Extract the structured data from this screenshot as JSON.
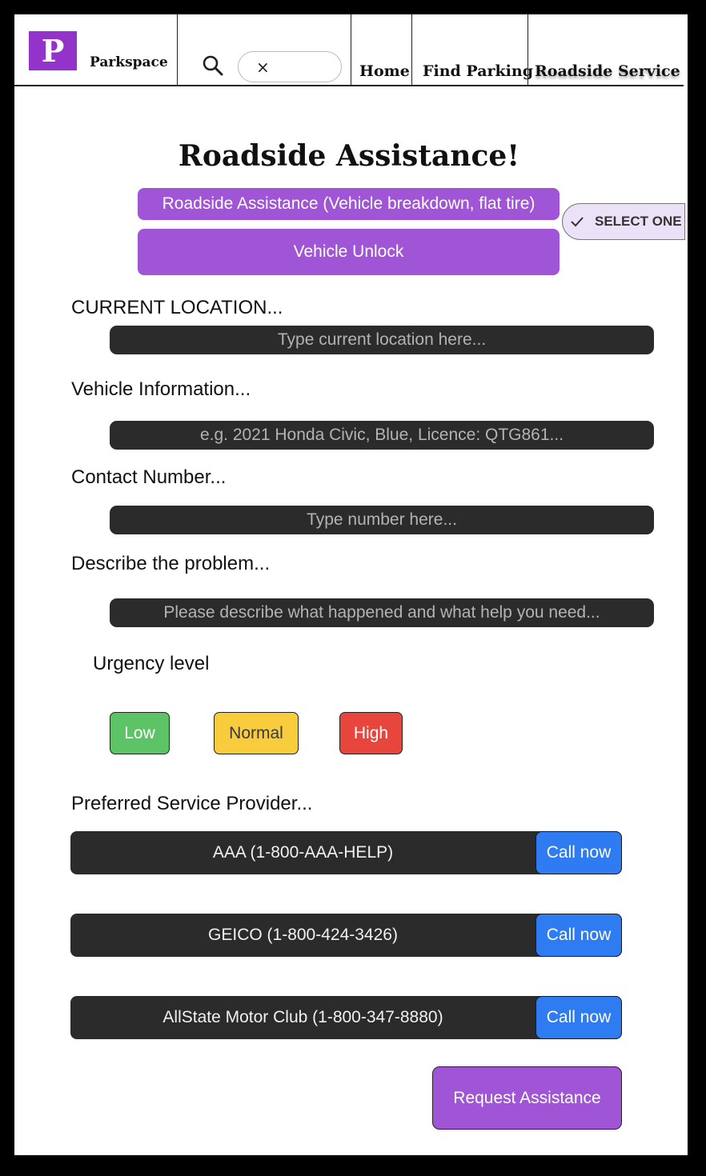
{
  "header": {
    "logo_letter": "P",
    "brand": "Parkspace",
    "search_clear_glyph": "×",
    "nav": [
      "Home",
      "Find Parking",
      "Roadside Service"
    ]
  },
  "main": {
    "title": "Roadside Assistance!",
    "service_options": [
      "Roadside Assistance (Vehicle breakdown, flat tire)",
      "Vehicle Unlock"
    ],
    "select_label": "SELECT ONE",
    "location_label": "CURRENT LOCATION...",
    "location_placeholder": "Type current location here...",
    "vehicle_label": "Vehicle Information...",
    "vehicle_placeholder": "e.g. 2021 Honda Civic, Blue, Licence: QTG861...",
    "contact_label": "Contact Number...",
    "contact_placeholder": "Type number here...",
    "problem_label": "Describe the problem...",
    "problem_placeholder": "Please describe what happened and what help you need...",
    "urgency_label": "Urgency level",
    "urgency": [
      {
        "label": "Low",
        "color": "#5cc466"
      },
      {
        "label": "Normal",
        "color": "#f8cc3d"
      },
      {
        "label": "High",
        "color": "#e8453c"
      }
    ],
    "provider_label": "Preferred Service Provider...",
    "providers": [
      {
        "name": "AAA (1-800-AAA-HELP)",
        "action": "Call now"
      },
      {
        "name": "GEICO (1-800-424-3426)",
        "action": "Call now"
      },
      {
        "name": "AllState Motor Club (1-800-347-8880)",
        "action": "Call now"
      }
    ],
    "request_button": "Request Assistance"
  },
  "colors": {
    "brand_purple": "#9333c9",
    "button_purple": "#9f55d6",
    "call_blue": "#2f7bf2",
    "field_dark": "#2b2b2b"
  },
  "icons": [
    "search-icon",
    "close-icon",
    "check-icon"
  ]
}
